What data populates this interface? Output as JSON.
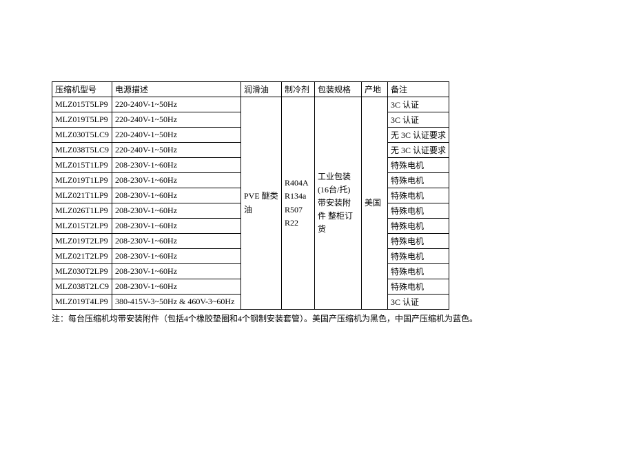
{
  "headers": {
    "model": "压缩机型号",
    "power": "电源描述",
    "lubricant": "润滑油",
    "refrigerant": "制冷剂",
    "packaging": "包装规格",
    "origin": "产地",
    "notes": "备注"
  },
  "merged": {
    "lubricant": "PVE 醚类油",
    "refrigerant": "R404A\nR134a\nR507\nR22",
    "packaging": "工业包装 (16台/托) 带安装附件 整柜订货",
    "origin": "美国"
  },
  "rows": [
    {
      "model": "MLZ015T5LP9",
      "power": "220-240V-1~50Hz",
      "notes": "3C 认证"
    },
    {
      "model": "MLZ019T5LP9",
      "power": "220-240V-1~50Hz",
      "notes": "3C 认证"
    },
    {
      "model": "MLZ030T5LC9",
      "power": "220-240V-1~50Hz",
      "notes": "无 3C 认证要求"
    },
    {
      "model": "MLZ038T5LC9",
      "power": "220-240V-1~50Hz",
      "notes": "无 3C 认证要求"
    },
    {
      "model": "MLZ015T1LP9",
      "power": "208-230V-1~60Hz",
      "notes": "特殊电机"
    },
    {
      "model": "MLZ019T1LP9",
      "power": "208-230V-1~60Hz",
      "notes": "特殊电机"
    },
    {
      "model": "MLZ021T1LP9",
      "power": "208-230V-1~60Hz",
      "notes": "特殊电机"
    },
    {
      "model": "MLZ026T1LP9",
      "power": "208-230V-1~60Hz",
      "notes": "特殊电机"
    },
    {
      "model": "MLZ015T2LP9",
      "power": "208-230V-1~60Hz",
      "notes": "特殊电机"
    },
    {
      "model": "MLZ019T2LP9",
      "power": "208-230V-1~60Hz",
      "notes": "特殊电机"
    },
    {
      "model": "MLZ021T2LP9",
      "power": "208-230V-1~60Hz",
      "notes": "特殊电机"
    },
    {
      "model": "MLZ030T2LP9",
      "power": "208-230V-1~60Hz",
      "notes": "特殊电机"
    },
    {
      "model": "MLZ038T2LC9",
      "power": "208-230V-1~60Hz",
      "notes": "特殊电机"
    },
    {
      "model": "MLZ019T4LP9",
      "power": "380-415V-3~50Hz & 460V-3~60Hz",
      "notes": "3C 认证"
    }
  ],
  "footnote": "注：每台压缩机均带安装附件（包括4个橡胶垫圈和4个钢制安装套管）。美国产压缩机为黑色，中国产压缩机为蓝色。"
}
